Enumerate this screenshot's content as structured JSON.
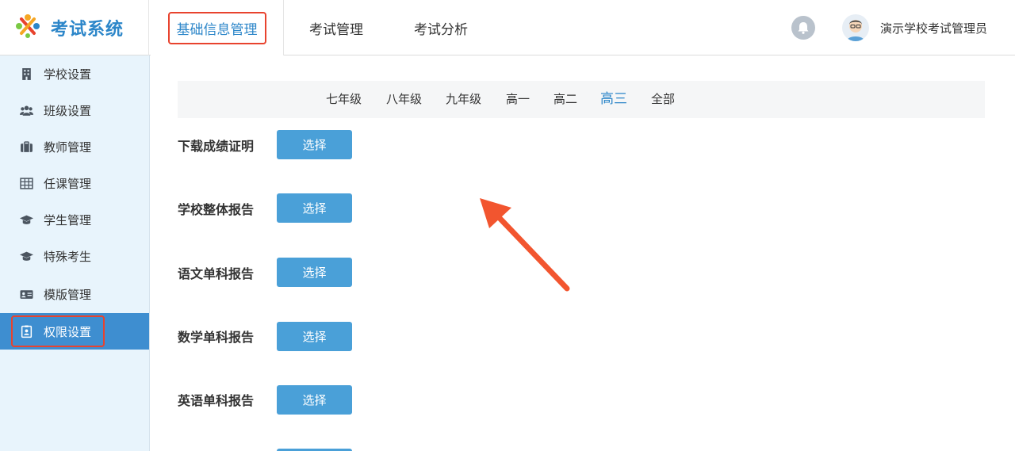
{
  "header": {
    "logo_text": "考试系统",
    "tabs": [
      {
        "label": "基础信息管理"
      },
      {
        "label": "考试管理"
      },
      {
        "label": "考试分析"
      }
    ],
    "user_name": "演示学校考试管理员"
  },
  "sidebar": {
    "items": [
      {
        "label": "学校设置",
        "icon": "building-icon"
      },
      {
        "label": "班级设置",
        "icon": "users-icon"
      },
      {
        "label": "教师管理",
        "icon": "briefcase-icon"
      },
      {
        "label": "任课管理",
        "icon": "grid-table-icon"
      },
      {
        "label": "学生管理",
        "icon": "graduation-cap-icon"
      },
      {
        "label": "特殊考生",
        "icon": "graduation-cap-icon"
      },
      {
        "label": "模版管理",
        "icon": "id-card-icon"
      },
      {
        "label": "权限设置",
        "icon": "badge-icon"
      }
    ]
  },
  "grades": {
    "items": [
      "七年级",
      "八年级",
      "九年级",
      "高一",
      "高二",
      "高三",
      "全部"
    ],
    "selected": "高三"
  },
  "reports": {
    "rows": [
      {
        "label": "下载成绩证明",
        "button": "选择"
      },
      {
        "label": "学校整体报告",
        "button": "选择"
      },
      {
        "label": "语文单科报告",
        "button": "选择"
      },
      {
        "label": "数学单科报告",
        "button": "选择"
      },
      {
        "label": "英语单科报告",
        "button": "选择"
      }
    ]
  },
  "colors": {
    "accent": "#2c86c9",
    "button": "#4aa0d8",
    "sidebar_bg": "#e8f4fc",
    "sidebar_active": "#3e8ed0",
    "highlight_red": "#e8432e"
  }
}
